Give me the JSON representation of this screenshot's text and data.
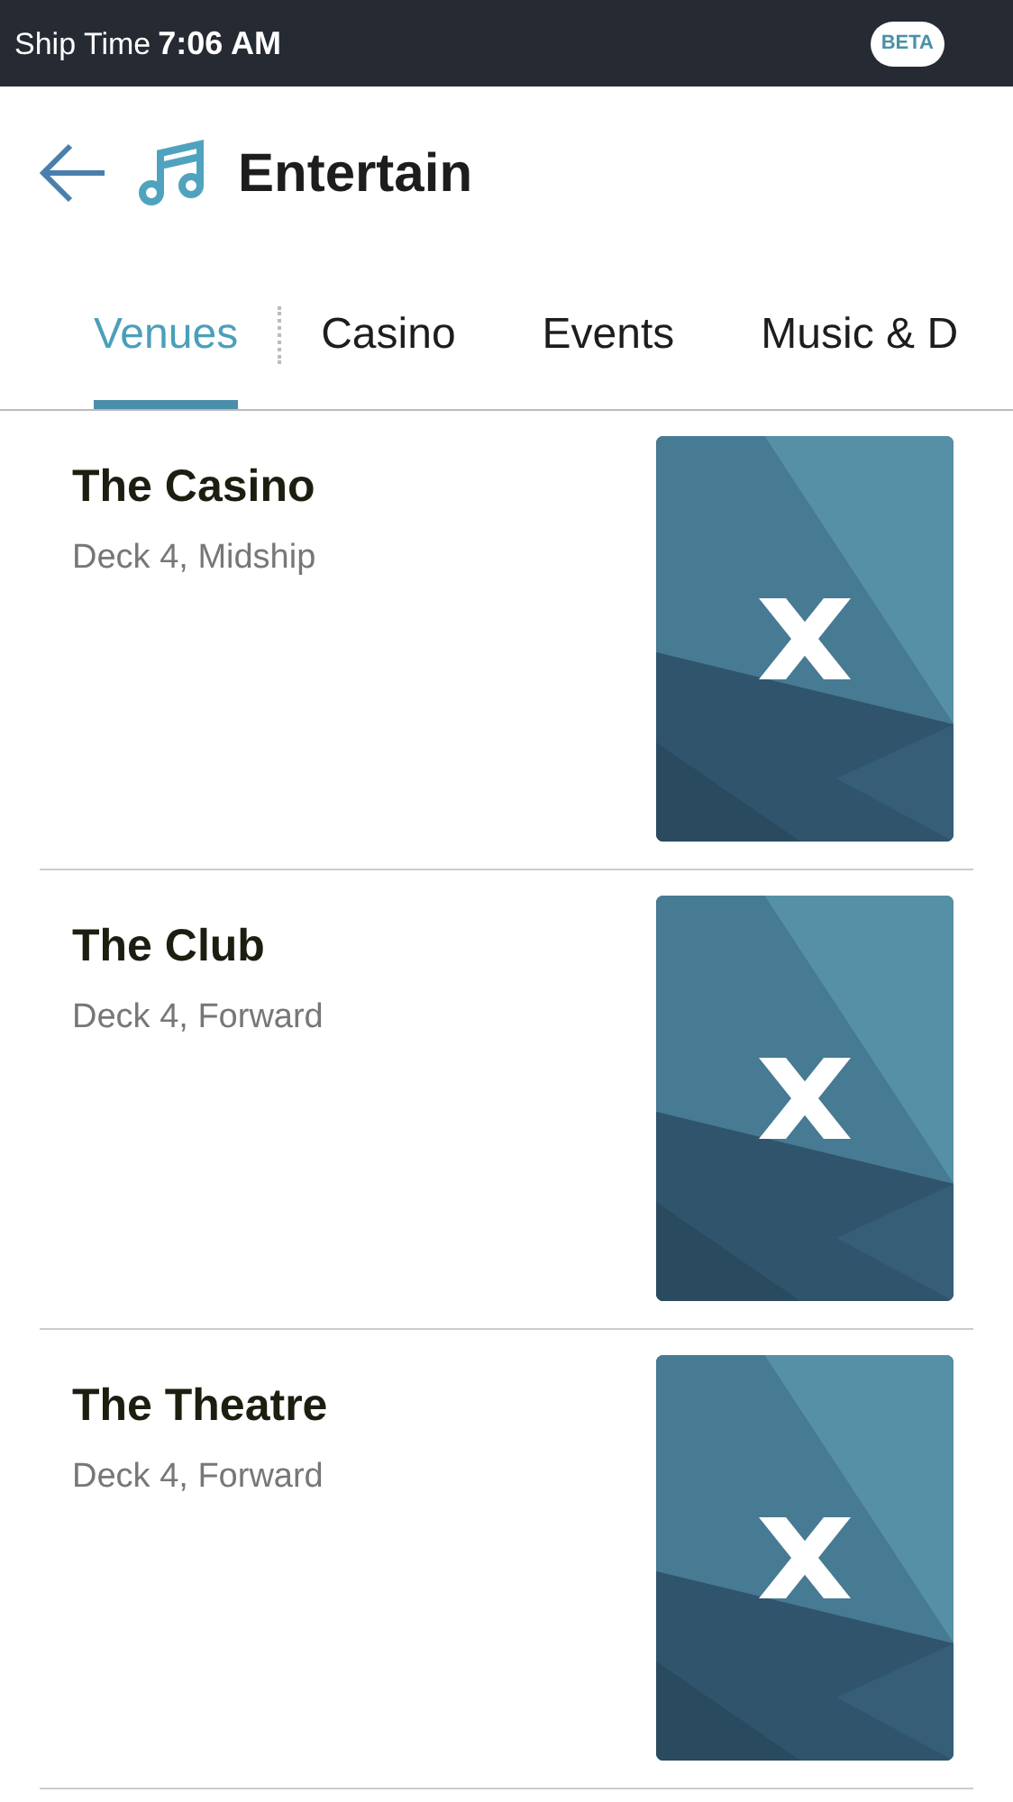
{
  "status_bar": {
    "label": "Ship Time",
    "time": "7:06 AM",
    "badge": "BETA"
  },
  "header": {
    "title": "Entertain"
  },
  "tabs": [
    {
      "label": "Venues",
      "selected": true
    },
    {
      "label": "Casino",
      "selected": false
    },
    {
      "label": "Events",
      "selected": false
    },
    {
      "label": "Music & D",
      "selected": false
    }
  ],
  "venues": [
    {
      "name": "The Casino",
      "location": "Deck 4, Midship"
    },
    {
      "name": "The Club",
      "location": "Deck 4, Forward"
    },
    {
      "name": "The Theatre",
      "location": "Deck 4, Forward"
    }
  ]
}
